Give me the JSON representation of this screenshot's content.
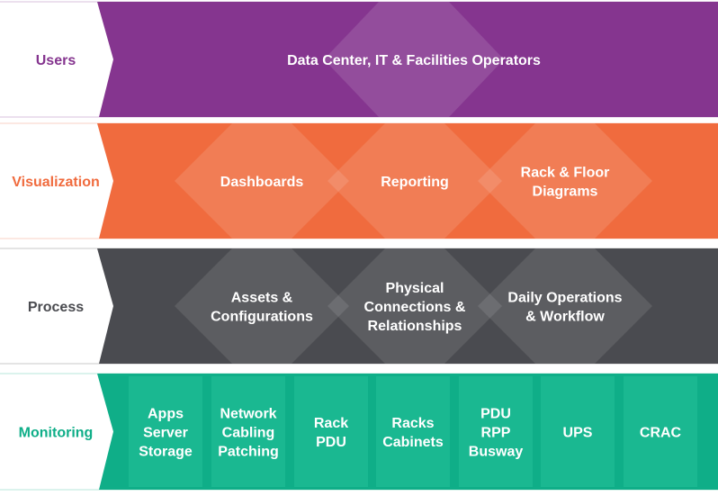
{
  "colors": {
    "users": "#85358f",
    "visualization": "#f06b3e",
    "process": "#4a4b50",
    "monitoring": "#0fae88",
    "monitoring_column": "#1ab891"
  },
  "rows": [
    {
      "label": "Users",
      "items": [
        [
          "Data Center, IT & Facilities  Operators"
        ]
      ]
    },
    {
      "label": "Visualization",
      "items": [
        [
          "Dashboards"
        ],
        [
          "Reporting"
        ],
        [
          "Rack & Floor",
          "Diagrams"
        ]
      ]
    },
    {
      "label": "Process",
      "items": [
        [
          "Assets &",
          "Configurations"
        ],
        [
          "Physical",
          "Connections &",
          "Relationships"
        ],
        [
          "Daily Operations",
          "& Workflow"
        ]
      ]
    },
    {
      "label": "Monitoring",
      "items": [
        [
          "Apps",
          "Server",
          "Storage"
        ],
        [
          "Network",
          "Cabling",
          "Patching"
        ],
        [
          "Rack",
          "PDU"
        ],
        [
          "Racks",
          "Cabinets"
        ],
        [
          "PDU",
          "RPP",
          "Busway"
        ],
        [
          "UPS"
        ],
        [
          "CRAC"
        ]
      ]
    }
  ]
}
